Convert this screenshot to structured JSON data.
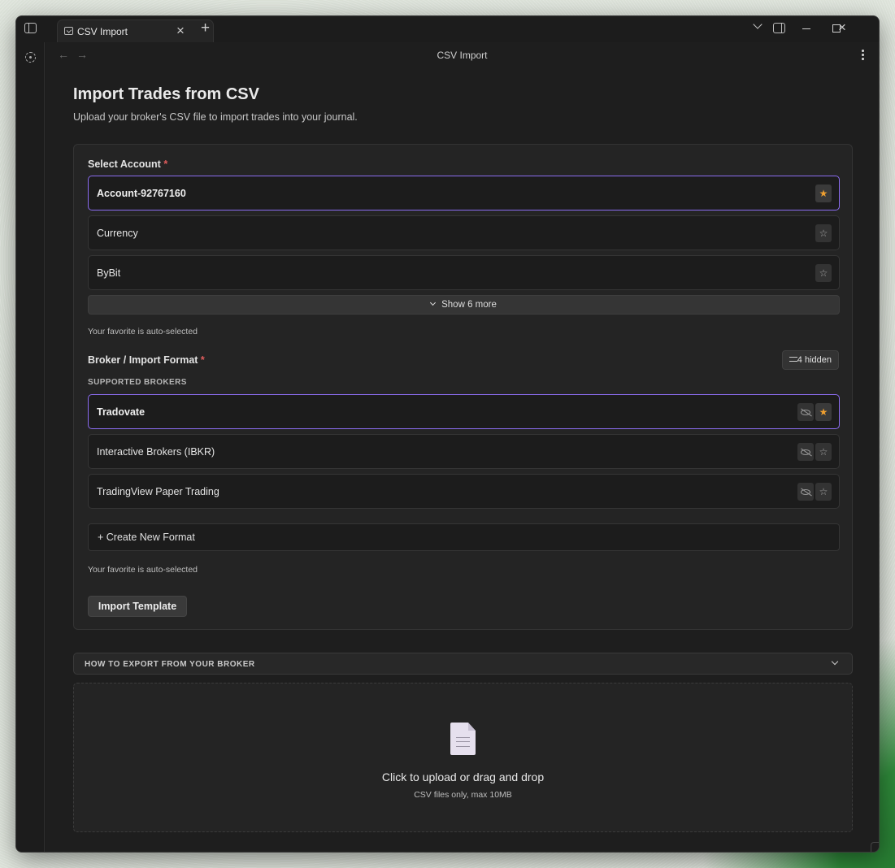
{
  "titlebar": {
    "tab_title": "CSV Import",
    "tab_close": "×",
    "new_tab": "+"
  },
  "navbar": {
    "title": "CSV Import",
    "back": "←",
    "forward": "→"
  },
  "page": {
    "title": "Import Trades from CSV",
    "subtitle": "Upload your broker's CSV file to import trades into your journal."
  },
  "account_section": {
    "label": "Select Account",
    "required_mark": "*",
    "accounts": [
      {
        "name": "Account-92767160",
        "selected": true,
        "favorite": true
      },
      {
        "name": "Currency",
        "selected": false,
        "favorite": false
      },
      {
        "name": "ByBit",
        "selected": false,
        "favorite": false
      }
    ],
    "show_more": "Show 6 more",
    "hint": "Your favorite is auto-selected"
  },
  "broker_section": {
    "label": "Broker / Import Format",
    "required_mark": "*",
    "hidden_button": "4 hidden",
    "group_caption": "SUPPORTED BROKERS",
    "brokers": [
      {
        "name": "Tradovate",
        "selected": true,
        "favorite": true
      },
      {
        "name": "Interactive Brokers (IBKR)",
        "selected": false,
        "favorite": false
      },
      {
        "name": "TradingView Paper Trading",
        "selected": false,
        "favorite": false
      }
    ],
    "create_format": "+ Create New Format",
    "hint": "Your favorite is auto-selected",
    "import_template": "Import Template"
  },
  "export_help": {
    "title": "HOW TO EXPORT FROM YOUR BROKER"
  },
  "upload": {
    "main_text": "Click to upload or drag and drop",
    "sub_text": "CSV files only, max 10MB"
  },
  "icons": {
    "star_filled": "★",
    "star_empty": "☆"
  },
  "colors": {
    "accent": "#8b6cf0",
    "favorite": "#f0a030",
    "required": "#e05d5d"
  }
}
